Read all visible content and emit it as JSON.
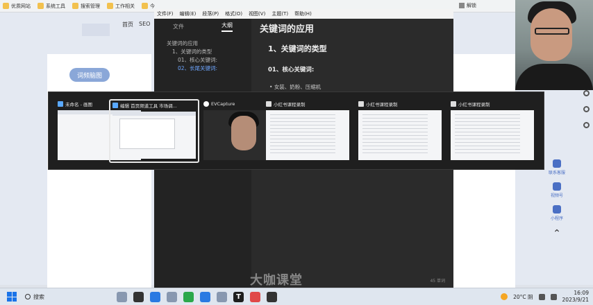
{
  "bookmarks": [
    {
      "label": "优质网站",
      "icon": "folder-icon"
    },
    {
      "label": "系统工具",
      "icon": "folder-icon"
    },
    {
      "label": "搜索管理",
      "icon": "folder-icon"
    },
    {
      "label": "工作相关",
      "icon": "folder-icon"
    },
    {
      "label": "今",
      "icon": "folder-icon"
    }
  ],
  "bookmark_right": "解锁",
  "site": {
    "nav": [
      "首页",
      "SEO"
    ],
    "word_map_button": "词频脑图"
  },
  "side_tools": [
    "联系客服",
    "视频号",
    "小程序"
  ],
  "note_app": {
    "menu": [
      "文件(F)",
      "编辑(E)",
      "段落(P)",
      "格式(O)",
      "视图(V)",
      "主题(T)",
      "帮助(H)"
    ],
    "tabs": [
      "文件",
      "大纲"
    ],
    "active_tab": "大纲",
    "outline": [
      {
        "text": "关键词的应用",
        "level": 1,
        "active": false
      },
      {
        "text": "1、关键词的类型",
        "level": 2,
        "active": false
      },
      {
        "text": "01、核心关键词:",
        "level": 3,
        "active": false
      },
      {
        "text": "02、长尾关键词:",
        "level": 3,
        "active": true
      }
    ],
    "h1": "关键词的应用",
    "h2": "1、关键词的类型",
    "h3": "01、核心关键词:",
    "bullet": "女装、奶粉、压缩机",
    "status": "45 单词"
  },
  "watermark": "大咖课堂",
  "switcher": {
    "items": [
      {
        "title": "未命名 - 画图",
        "icon": "paint-icon",
        "selected": false
      },
      {
        "title": "编辑 首页频道工具 市场调...",
        "icon": "browser-icon",
        "selected": true
      },
      {
        "title": "EVCapture",
        "icon": "evcapture-icon",
        "selected": false
      },
      {
        "title": "小红书课程录制",
        "icon": "note-icon",
        "selected": false
      },
      {
        "title": "小红书课程录制",
        "icon": "note-icon",
        "selected": false
      },
      {
        "title": "小红书课程录制",
        "icon": "note-icon",
        "selected": false
      }
    ]
  },
  "taskbar": {
    "search_placeholder": "搜索",
    "weather": "20°C 阴",
    "time": "16:09",
    "date": "2023/9/21"
  }
}
